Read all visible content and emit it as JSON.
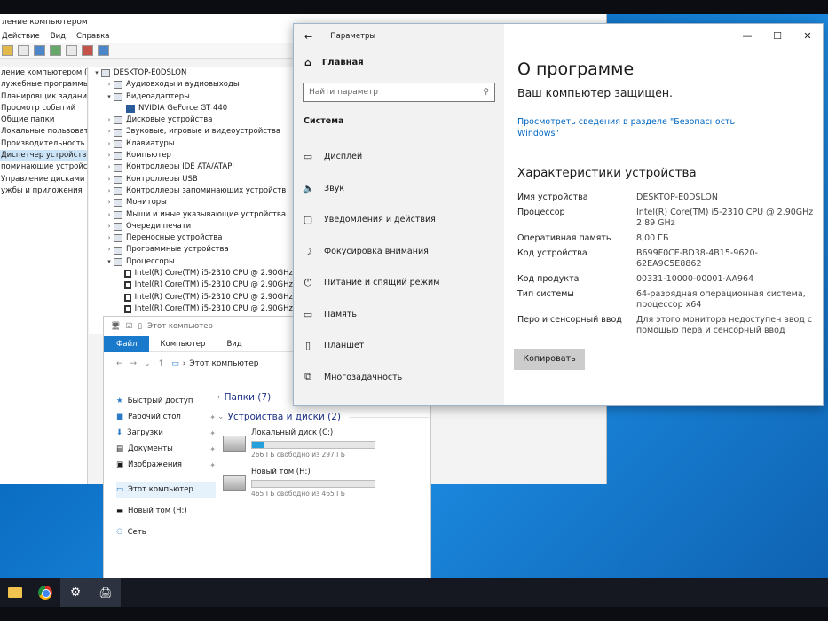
{
  "computer_management": {
    "title": "ление компьютером",
    "menu": [
      "Действие",
      "Вид",
      "Справка"
    ],
    "left_items": [
      "ление компьютером (л",
      "лужебные программы",
      "Планировщик заданий",
      "Просмотр событий",
      "Общие папки",
      "Локальные пользовате",
      "Производительность",
      "Диспетчер устройств",
      "поминающие устройст",
      "Управление дисками",
      "ужбы и приложения"
    ],
    "tree": [
      {
        "label": "DESKTOP-E0DSLON",
        "arrow": "▾",
        "indent": 0
      },
      {
        "label": "Аудиовходы и аудиовыходы",
        "arrow": "›",
        "indent": 1
      },
      {
        "label": "Видеоадаптеры",
        "arrow": "▾",
        "indent": 1
      },
      {
        "label": "NVIDIA GeForce GT 440",
        "arrow": "",
        "indent": 2
      },
      {
        "label": "Дисковые устройства",
        "arrow": "›",
        "indent": 1
      },
      {
        "label": "Звуковые, игровые и видеоустройства",
        "arrow": "›",
        "indent": 1
      },
      {
        "label": "Клавиатуры",
        "arrow": "›",
        "indent": 1
      },
      {
        "label": "Компьютер",
        "arrow": "›",
        "indent": 1
      },
      {
        "label": "Контроллеры IDE ATA/ATAPI",
        "arrow": "›",
        "indent": 1
      },
      {
        "label": "Контроллеры USB",
        "arrow": "›",
        "indent": 1
      },
      {
        "label": "Контроллеры запоминающих устройств",
        "arrow": "›",
        "indent": 1
      },
      {
        "label": "Мониторы",
        "arrow": "›",
        "indent": 1
      },
      {
        "label": "Мыши и иные указывающие устройства",
        "arrow": "›",
        "indent": 1
      },
      {
        "label": "Очереди печати",
        "arrow": "›",
        "indent": 1
      },
      {
        "label": "Переносные устройства",
        "arrow": "›",
        "indent": 1
      },
      {
        "label": "Программные устройства",
        "arrow": "›",
        "indent": 1
      },
      {
        "label": "Процессоры",
        "arrow": "▾",
        "indent": 1
      },
      {
        "label": "Intel(R) Core(TM) i5-2310 CPU @ 2.90GHz",
        "arrow": "",
        "indent": 2
      },
      {
        "label": "Intel(R) Core(TM) i5-2310 CPU @ 2.90GHz",
        "arrow": "",
        "indent": 2
      },
      {
        "label": "Intel(R) Core(TM) i5-2310 CPU @ 2.90GHz",
        "arrow": "",
        "indent": 2
      },
      {
        "label": "Intel(R) Core(TM) i5-2310 CPU @ 2.90GHz",
        "arrow": "",
        "indent": 2
      }
    ]
  },
  "explorer": {
    "title": "Этот компьютер",
    "ribbon": {
      "file": "Файл",
      "computer": "Компьютер",
      "view": "Вид"
    },
    "address": "Этот компьютер",
    "nav": {
      "quick": "Быстрый доступ",
      "desktop": "Рабочий стол",
      "downloads": "Загрузки",
      "documents": "Документы",
      "images": "Изображения",
      "this_pc": "Этот компьютер",
      "new_volume": "Новый том (H:)",
      "network": "Сеть"
    },
    "folders_group": "Папки (7)",
    "devices_group": "Устройства и диски (2)",
    "drives": [
      {
        "name": "Локальный диск (C:)",
        "free": "266 ГБ свободно из 297 ГБ",
        "used_fraction": 0.105
      },
      {
        "name": "Новый том (H:)",
        "free": "465 ГБ свободно из 465 ГБ",
        "used_fraction": 0.0
      }
    ]
  },
  "settings": {
    "title": "Параметры",
    "home": "Главная",
    "search_placeholder": "Найти параметр",
    "section": "Система",
    "nav": [
      {
        "icon": "display-icon",
        "glyph": "▭",
        "label": "Дисплей"
      },
      {
        "icon": "sound-icon",
        "glyph": "🔈",
        "label": "Звук"
      },
      {
        "icon": "notifications-icon",
        "glyph": "▢",
        "label": "Уведомления и действия"
      },
      {
        "icon": "focus-assist-icon",
        "glyph": "☽",
        "label": "Фокусировка внимания"
      },
      {
        "icon": "power-icon",
        "glyph": "⏻",
        "label": "Питание и спящий режим"
      },
      {
        "icon": "storage-icon",
        "glyph": "▭",
        "label": "Память"
      },
      {
        "icon": "tablet-icon",
        "glyph": "▯",
        "label": "Планшет"
      },
      {
        "icon": "multitasking-icon",
        "glyph": "⧉",
        "label": "Многозадачность"
      }
    ],
    "page_title": "О программе",
    "protected": "Ваш компьютер защищен.",
    "security_link": "Просмотреть сведения в разделе \"Безопасность Windows\"",
    "specs_title": "Характеристики устройства",
    "specs": [
      {
        "key": "Имя устройства",
        "value": "DESKTOP-E0DSLON"
      },
      {
        "key": "Процессор",
        "value": "Intel(R) Core(TM) i5-2310 CPU @ 2.90GHz 2.89 GHz"
      },
      {
        "key": "Оперативная память",
        "value": "8,00 ГБ"
      },
      {
        "key": "Код устройства",
        "value": "B699F0CE-BD38-4B15-9620-62EA9C5E8862"
      },
      {
        "key": "Код продукта",
        "value": "00331-10000-00001-AA964"
      },
      {
        "key": "Тип системы",
        "value": "64-разрядная операционная система, процессор x64"
      },
      {
        "key": "Перо и сенсорный ввод",
        "value": "Для этого монитора недоступен ввод с помощью пера и сенсорный ввод"
      }
    ],
    "copy_button": "Копировать"
  },
  "taskbar": {
    "items": [
      "file-explorer-icon",
      "chrome-icon",
      "settings-icon",
      "device-manager-icon"
    ],
    "active_color": "#2c3240"
  }
}
